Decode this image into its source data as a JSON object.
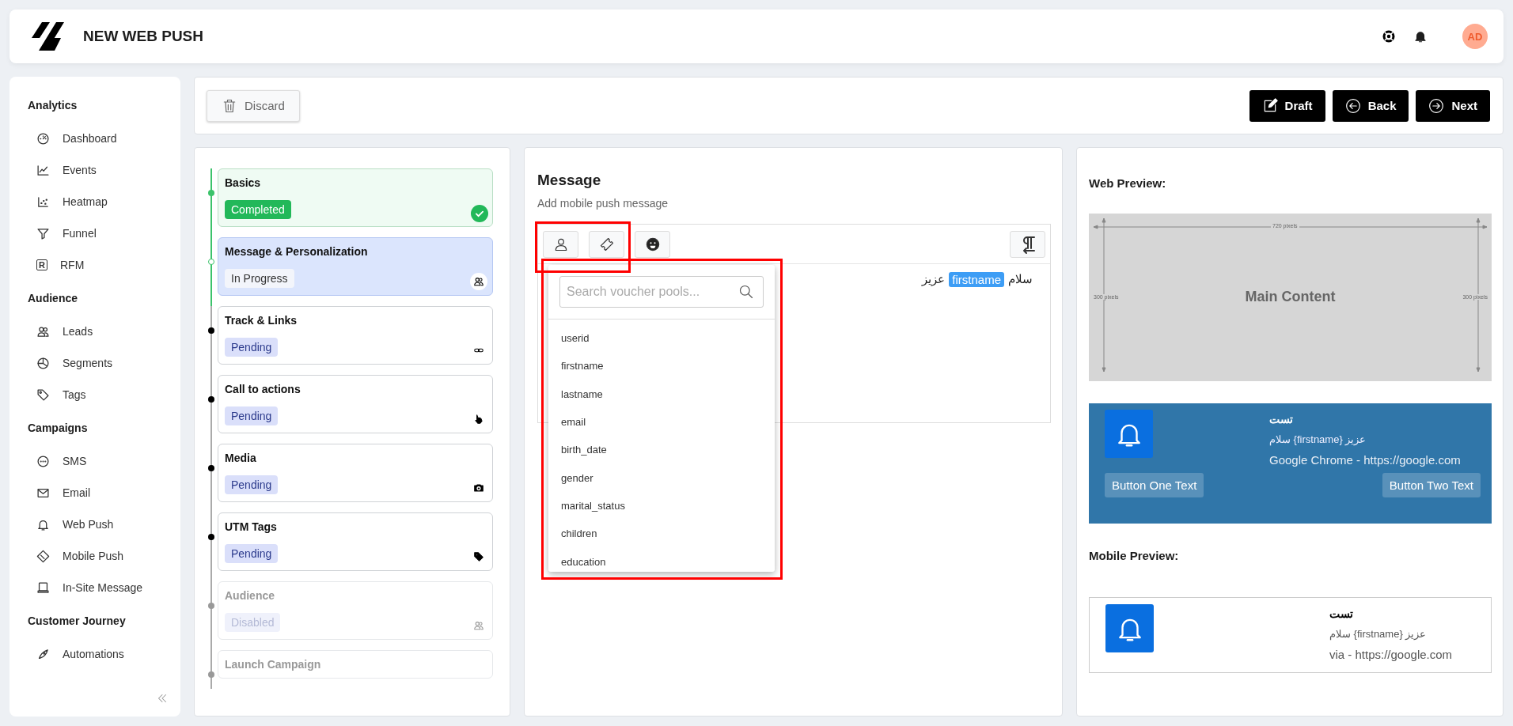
{
  "header": {
    "title": "NEW WEB PUSH",
    "avatar": "AD"
  },
  "sidebar": {
    "sections": [
      {
        "title": "Analytics",
        "items": [
          {
            "label": "Dashboard"
          },
          {
            "label": "Events"
          },
          {
            "label": "Heatmap"
          },
          {
            "label": "Funnel"
          },
          {
            "label": "RFM",
            "letter": "R"
          }
        ]
      },
      {
        "title": "Audience",
        "items": [
          {
            "label": "Leads"
          },
          {
            "label": "Segments"
          },
          {
            "label": "Tags"
          }
        ]
      },
      {
        "title": "Campaigns",
        "items": [
          {
            "label": "SMS"
          },
          {
            "label": "Email"
          },
          {
            "label": "Web Push"
          },
          {
            "label": "Mobile Push"
          },
          {
            "label": "In-Site Message"
          }
        ]
      },
      {
        "title": "Customer Journey",
        "items": [
          {
            "label": "Automations"
          }
        ]
      }
    ]
  },
  "actions": {
    "discard": "Discard",
    "buttons": [
      "Draft",
      "Back",
      "Next"
    ]
  },
  "steps": [
    {
      "title": "Basics",
      "kind": "completed",
      "status_label": "Completed"
    },
    {
      "title": "Message & Personalization",
      "kind": "in_progress",
      "status_label": "In Progress"
    },
    {
      "title": "Track & Links",
      "kind": "pending",
      "status_label": "Pending"
    },
    {
      "title": "Call to actions",
      "kind": "pending",
      "status_label": "Pending"
    },
    {
      "title": "Media",
      "kind": "pending",
      "status_label": "Pending"
    },
    {
      "title": "UTM Tags",
      "kind": "pending",
      "status_label": "Pending"
    },
    {
      "title": "Audience",
      "kind": "disabled",
      "status_label": "Disabled"
    },
    {
      "title": "Launch Campaign",
      "kind": "disabled"
    }
  ],
  "message": {
    "title": "Message",
    "subtitle": "Add mobile push message",
    "toolbar_highlighted": true,
    "content": [
      {
        "kind": "text",
        "text": "سلام"
      },
      {
        "kind": "variable",
        "text": "firstname"
      },
      {
        "kind": "text",
        "text": "عزیز"
      }
    ],
    "dropdown": {
      "highlighted": true,
      "search_placeholder": "Search voucher pools...",
      "items": [
        "userid",
        "firstname",
        "lastname",
        "email",
        "birth_date",
        "gender",
        "marital_status",
        "children",
        "education"
      ]
    }
  },
  "web_preview": {
    "title": "Web Preview:",
    "mockup": {
      "width_label": "720 pixels",
      "left_height_label": "300 pixels",
      "right_height_label": "300 pixels",
      "caption": "Main Content"
    },
    "notification": {
      "title": "تست",
      "body": "سلام {firstname} عزیز",
      "source": "Google Chrome - https://google.com",
      "buttons": [
        "Button One Text",
        "Button Two Text"
      ]
    }
  },
  "mobile_preview": {
    "title": "Mobile Preview:",
    "notification": {
      "title": "تست",
      "body": "سلام {firstname} عزیز",
      "source": "via - https://google.com"
    }
  }
}
